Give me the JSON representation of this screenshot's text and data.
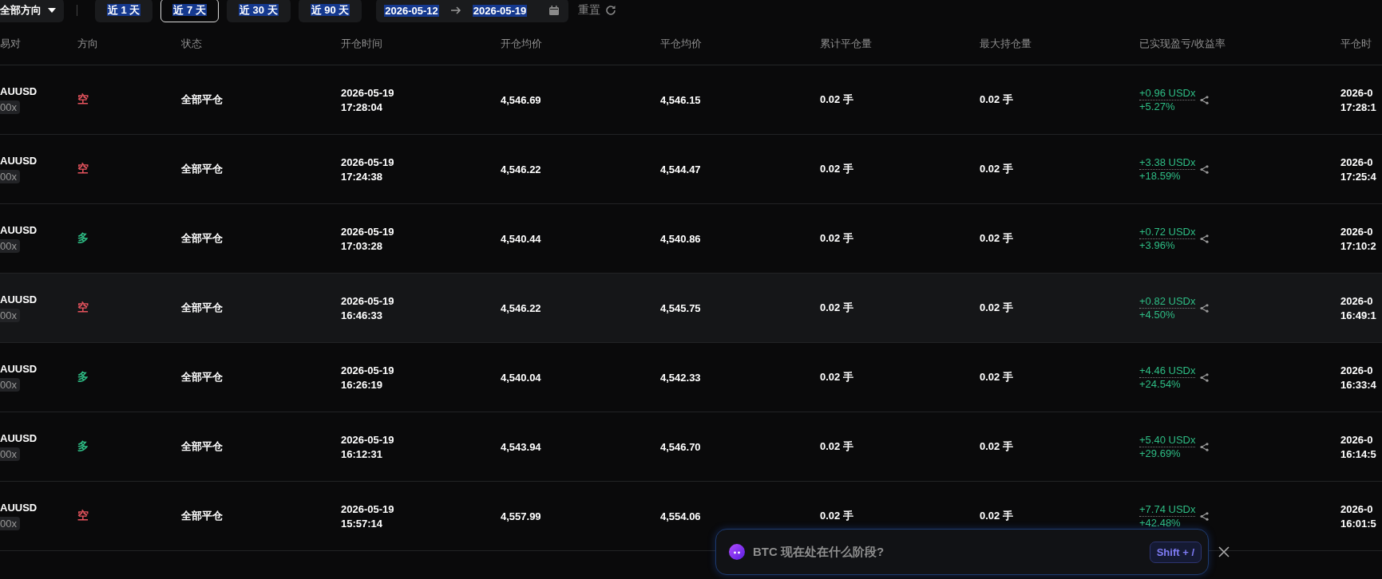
{
  "toolbar": {
    "direction_filter": "全部方向",
    "ranges": [
      {
        "label": "近 1 天",
        "selected": false
      },
      {
        "label": "近 7 天",
        "selected": true
      },
      {
        "label": "近 30 天",
        "selected": false
      },
      {
        "label": "近 90 天",
        "selected": false
      }
    ],
    "date_start": "2026-05-12",
    "date_end": "2026-05-19",
    "reset": "重置"
  },
  "table": {
    "columns": [
      "易对",
      "方向",
      "状态",
      "开仓时间",
      "开仓均价",
      "平仓均价",
      "累计平仓量",
      "最大持仓量",
      "已实现盈亏/收益率",
      "平仓时"
    ],
    "rows": [
      {
        "pair": "AUUSD",
        "leverage": "00x",
        "direction": "空",
        "color": "#e4535d",
        "status": "全部平仓",
        "open_date": "2026-05-19",
        "open_time": "17:28:04",
        "open_price": "4,546.69",
        "close_price": "4,546.15",
        "closed_qty": "0.02 手",
        "max_qty": "0.02 手",
        "pnl": "+0.96 USDx",
        "pnl_rate": "+5.27%",
        "close_date": "2026-0",
        "close_time": "17:28:1",
        "hovered": false
      },
      {
        "pair": "AUUSD",
        "leverage": "00x",
        "direction": "空",
        "color": "#e4535d",
        "status": "全部平仓",
        "open_date": "2026-05-19",
        "open_time": "17:24:38",
        "open_price": "4,546.22",
        "close_price": "4,544.47",
        "closed_qty": "0.02 手",
        "max_qty": "0.02 手",
        "pnl": "+3.38 USDx",
        "pnl_rate": "+18.59%",
        "close_date": "2026-0",
        "close_time": "17:25:4",
        "hovered": false
      },
      {
        "pair": "AUUSD",
        "leverage": "00x",
        "direction": "多",
        "color": "#2ebd85",
        "status": "全部平仓",
        "open_date": "2026-05-19",
        "open_time": "17:03:28",
        "open_price": "4,540.44",
        "close_price": "4,540.86",
        "closed_qty": "0.02 手",
        "max_qty": "0.02 手",
        "pnl": "+0.72 USDx",
        "pnl_rate": "+3.96%",
        "close_date": "2026-0",
        "close_time": "17:10:2",
        "hovered": false
      },
      {
        "pair": "AUUSD",
        "leverage": "00x",
        "direction": "空",
        "color": "#e4535d",
        "status": "全部平仓",
        "open_date": "2026-05-19",
        "open_time": "16:46:33",
        "open_price": "4,546.22",
        "close_price": "4,545.75",
        "closed_qty": "0.02 手",
        "max_qty": "0.02 手",
        "pnl": "+0.82 USDx",
        "pnl_rate": "+4.50%",
        "close_date": "2026-0",
        "close_time": "16:49:1",
        "hovered": true
      },
      {
        "pair": "AUUSD",
        "leverage": "00x",
        "direction": "多",
        "color": "#2ebd85",
        "status": "全部平仓",
        "open_date": "2026-05-19",
        "open_time": "16:26:19",
        "open_price": "4,540.04",
        "close_price": "4,542.33",
        "closed_qty": "0.02 手",
        "max_qty": "0.02 手",
        "pnl": "+4.46 USDx",
        "pnl_rate": "+24.54%",
        "close_date": "2026-0",
        "close_time": "16:33:4",
        "hovered": false
      },
      {
        "pair": "AUUSD",
        "leverage": "00x",
        "direction": "多",
        "color": "#2ebd85",
        "status": "全部平仓",
        "open_date": "2026-05-19",
        "open_time": "16:12:31",
        "open_price": "4,543.94",
        "close_price": "4,546.70",
        "closed_qty": "0.02 手",
        "max_qty": "0.02 手",
        "pnl": "+5.40 USDx",
        "pnl_rate": "+29.69%",
        "close_date": "2026-0",
        "close_time": "16:14:5",
        "hovered": false
      },
      {
        "pair": "AUUSD",
        "leverage": "00x",
        "direction": "空",
        "color": "#e4535d",
        "status": "全部平仓",
        "open_date": "2026-05-19",
        "open_time": "15:57:14",
        "open_price": "4,557.99",
        "close_price": "4,554.06",
        "closed_qty": "0.02 手",
        "max_qty": "0.02 手",
        "pnl": "+7.74 USDx",
        "pnl_rate": "+42.48%",
        "close_date": "2026-0",
        "close_time": "16:01:5",
        "hovered": false
      }
    ]
  },
  "assistant_bar": {
    "prompt": "BTC 现在处在什么阶段?",
    "shortcut": "Shift + /"
  }
}
